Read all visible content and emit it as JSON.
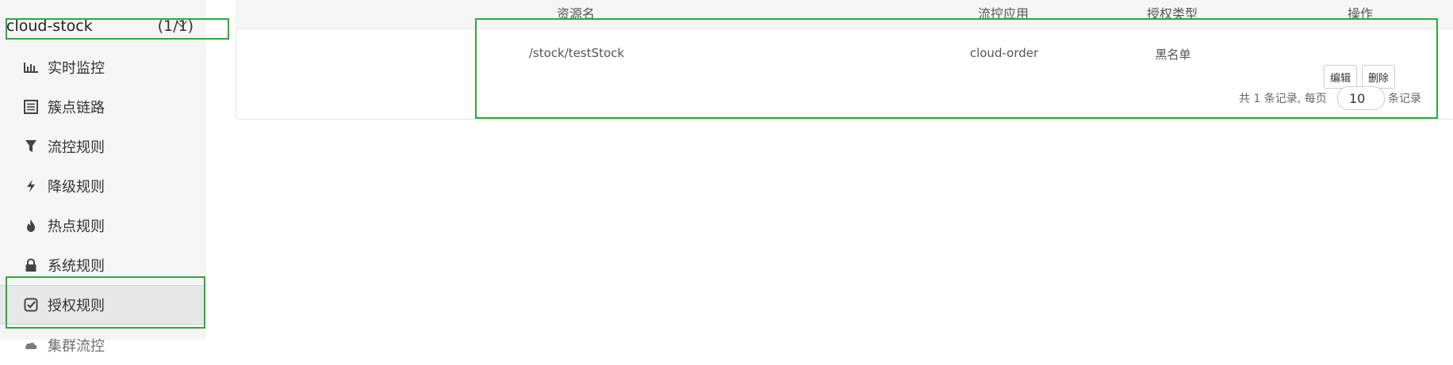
{
  "sidebar": {
    "app": {
      "name": "cloud-stock",
      "count": "(1/1)"
    },
    "items": [
      {
        "label": "实时监控",
        "icon": "bar-chart-icon"
      },
      {
        "label": "簇点链路",
        "icon": "list-icon"
      },
      {
        "label": "流控规则",
        "icon": "filter-icon"
      },
      {
        "label": "降级规则",
        "icon": "flash-icon"
      },
      {
        "label": "热点规则",
        "icon": "fire-icon"
      },
      {
        "label": "系统规则",
        "icon": "lock-icon"
      },
      {
        "label": "授权规则",
        "icon": "check-square-icon",
        "active": true
      },
      {
        "label": "集群流控",
        "icon": "cloud-icon"
      }
    ]
  },
  "table": {
    "headers": [
      "资源名",
      "流控应用",
      "授权类型",
      "操作"
    ],
    "rows": [
      {
        "resource": "/stock/testStock",
        "app": "cloud-order",
        "type": "黑名单",
        "edit_label": "编辑",
        "delete_label": "删除"
      }
    ]
  },
  "pagination": {
    "summary": "共 1 条记录, 每页",
    "page_size": "10",
    "suffix": "条记录"
  },
  "colors": {
    "highlight": "#2eaa3c",
    "sidebar_bg": "#f5f5f5"
  }
}
